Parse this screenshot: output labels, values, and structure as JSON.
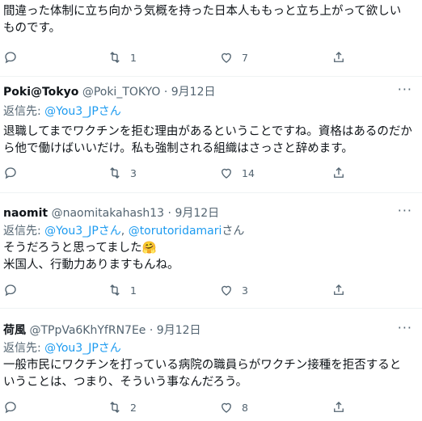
{
  "tweets": [
    {
      "text": "間違った体制に立ち向かう気概を持った日本人ももっと立ち上がって欲しいものです。",
      "reply_count": "",
      "retweet_count": "1",
      "like_count": "7"
    },
    {
      "name": "Poki@Tokyo",
      "handle": "@Poki_TOKYO",
      "sep": "·",
      "date": "9月12日",
      "reply_prefix": "返信先: ",
      "reply_to": "@You3_JPさん",
      "text": "退職してまでワクチンを拒む理由があるということですね。資格はあるのだから他で働けばいいだけ。私も強制される組織はさっさと辞めます。",
      "reply_count": "",
      "retweet_count": "3",
      "like_count": "14"
    },
    {
      "name": "naomit",
      "handle": "@naomitakahash13",
      "sep": "·",
      "date": "9月12日",
      "reply_prefix": "返信先: ",
      "reply_to": "@You3_JPさん",
      "reply_join": ", ",
      "reply_to_2": "@torutoridamari",
      "reply_suffix": "さん",
      "text": "そうだろうと思ってました🤗\n米国人、行動力ありますもんね。",
      "reply_count": "",
      "retweet_count": "1",
      "like_count": "3"
    },
    {
      "name": "荷風",
      "handle": "@TPpVa6KhYfRN7Ee",
      "sep": "·",
      "date": "9月12日",
      "reply_prefix": "返信先: ",
      "reply_to": "@You3_JPさん",
      "text": "一般市民にワクチンを打っている病院の職員らがワクチン接種を拒否するということは、つまり、そういう事なんだろう。",
      "reply_count": "",
      "retweet_count": "2",
      "like_count": "8"
    }
  ],
  "more_label": "···"
}
